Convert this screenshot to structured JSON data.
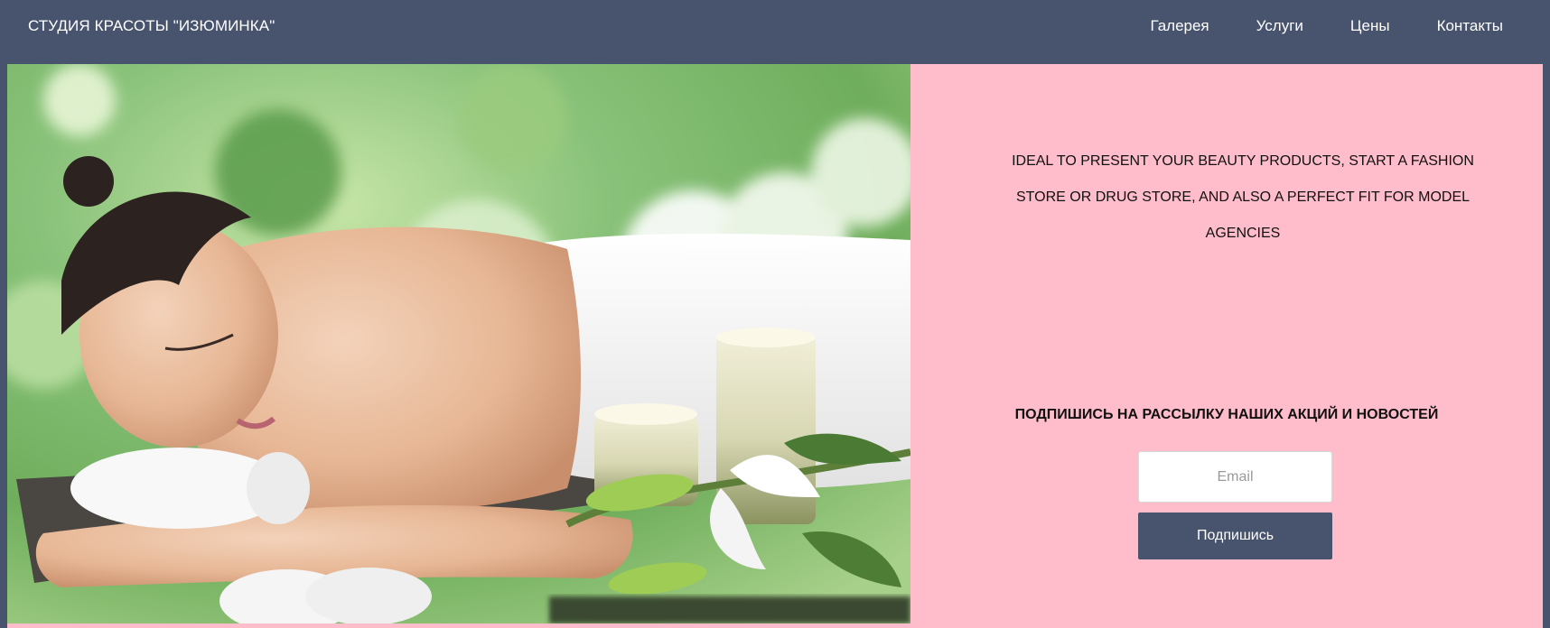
{
  "header": {
    "brand": "СТУДИЯ КРАСОТЫ \"ИЗЮМИНКА\"",
    "nav": [
      {
        "label": "Галерея"
      },
      {
        "label": "Услуги"
      },
      {
        "label": "Цены"
      },
      {
        "label": "Контакты"
      }
    ]
  },
  "panel": {
    "tagline": "IDEAL TO PRESENT YOUR BEAUTY PRODUCTS, START A FASHION STORE OR DRUG STORE, AND ALSO A PERFECT FIT FOR MODEL AGENCIES",
    "subscribe_title": "ПОДПИШИСЬ НА РАССЫЛКУ НАШИХ АКЦИЙ И НОВОСТЕЙ",
    "email_placeholder": "Email",
    "subscribe_button": "Подпишись"
  },
  "colors": {
    "header_bg": "#48536d",
    "panel_bg": "#ffbcca",
    "button_bg": "#48536d"
  }
}
